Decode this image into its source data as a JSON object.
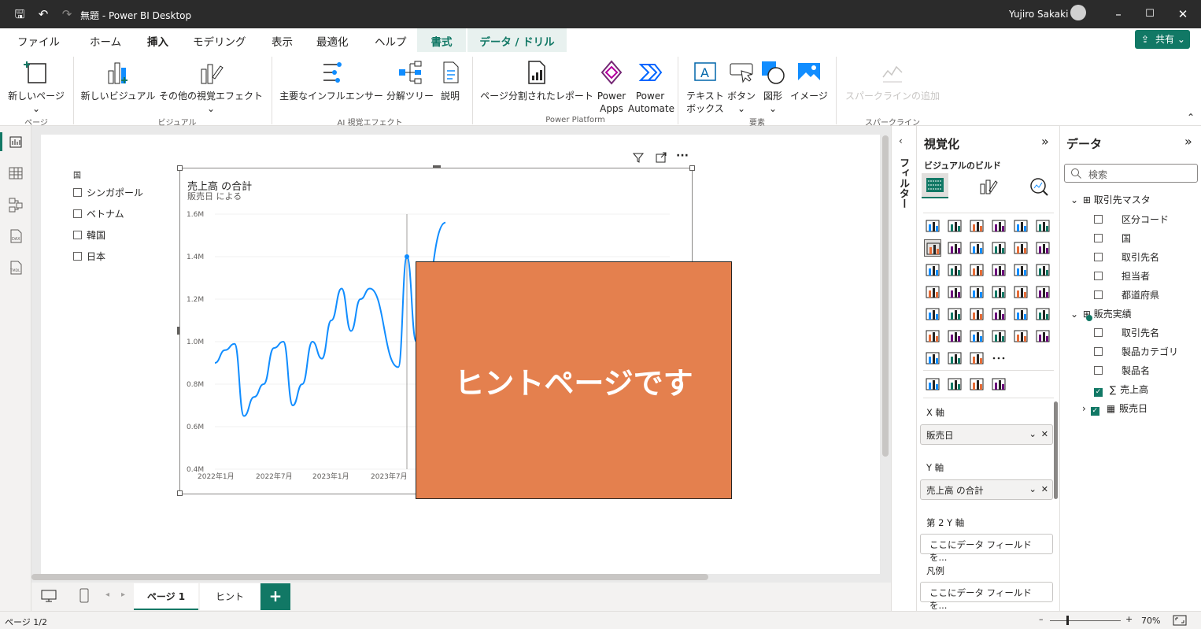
{
  "titlebar": {
    "title": "無題 - Power BI Desktop",
    "user": "Yujiro Sakaki"
  },
  "menu": {
    "file": "ファイル",
    "home": "ホーム",
    "insert": "挿入",
    "modeling": "モデリング",
    "view": "表示",
    "optimize": "最適化",
    "help": "ヘルプ",
    "format": "書式",
    "data_drill": "データ / ドリル",
    "share": "共有"
  },
  "ribbon": {
    "new_page": "新しいページ",
    "grp_page": "ページ",
    "new_visual": "新しいビジュアル",
    "more_visuals": "その他の視覚エフェクト",
    "grp_visual": "ビジュアル",
    "key_influencers": "主要なインフルエンサー",
    "decomp_tree": "分解ツリー",
    "narrative": "説明",
    "grp_ai": "AI 視覚エフェクト",
    "paginated": "ページ分割されたレポート",
    "power_apps_1": "Power",
    "power_apps_2": "Apps",
    "power_automate_1": "Power",
    "power_automate_2": "Automate",
    "grp_platform": "Power Platform",
    "textbox_1": "テキスト",
    "textbox_2": "ボックス",
    "buttons": "ボタン",
    "shapes": "図形",
    "image": "イメージ",
    "grp_elements": "要素",
    "sparkline": "スパークラインの追加",
    "grp_sparkline": "スパークライン"
  },
  "slicer": {
    "title": "国",
    "items": [
      "シンガポール",
      "ベトナム",
      "韓国",
      "日本"
    ]
  },
  "visual": {
    "title": "売上高 の合計",
    "subtitle": "販売日 による"
  },
  "chart_data": {
    "type": "line",
    "title": "売上高 の合計",
    "subtitle": "販売日 による",
    "y_ticks": [
      "1.6M",
      "1.4M",
      "1.2M",
      "1.0M",
      "0.8M",
      "0.6M",
      "0.4M"
    ],
    "x_ticks": [
      "2022年1月",
      "2022年7月",
      "2023年1月",
      "2023年7月"
    ],
    "ylim": [
      400000,
      1600000
    ],
    "series": [
      {
        "values": [
          900000,
          960000,
          990000,
          650000,
          740000,
          800000,
          970000,
          1000000,
          700000,
          800000,
          1000000,
          920000,
          1100000,
          1250000,
          1050000,
          1200000,
          1250000,
          880000,
          1400000,
          1000000,
          1560000
        ]
      }
    ]
  },
  "hint": {
    "text": "ヒントページです"
  },
  "filters": {
    "label": "フィルター"
  },
  "viz": {
    "title": "視覚化",
    "build": "ビジュアルのビルド",
    "x_axis": "X 軸",
    "x_field": "販売日",
    "y_axis": "Y 軸",
    "y_field": "売上高 の合計",
    "y2_axis": "第 2 Y 軸",
    "y2_placeholder": "ここにデータ フィールドを...",
    "legend": "凡例",
    "legend_placeholder": "ここにデータ フィールドを..."
  },
  "data": {
    "title": "データ",
    "search_placeholder": "検索",
    "table1": "取引先マスタ",
    "table1_fields": [
      "区分コード",
      "国",
      "取引先名",
      "担当者",
      "都道府県"
    ],
    "table2": "販売実績",
    "table2_fields": [
      "取引先名",
      "製品カテゴリ",
      "製品名",
      "売上高",
      "販売日"
    ]
  },
  "pages": {
    "page1": "ページ 1",
    "page2": "ヒント"
  },
  "status": {
    "page": "ページ 1/2",
    "zoom": "70%"
  }
}
